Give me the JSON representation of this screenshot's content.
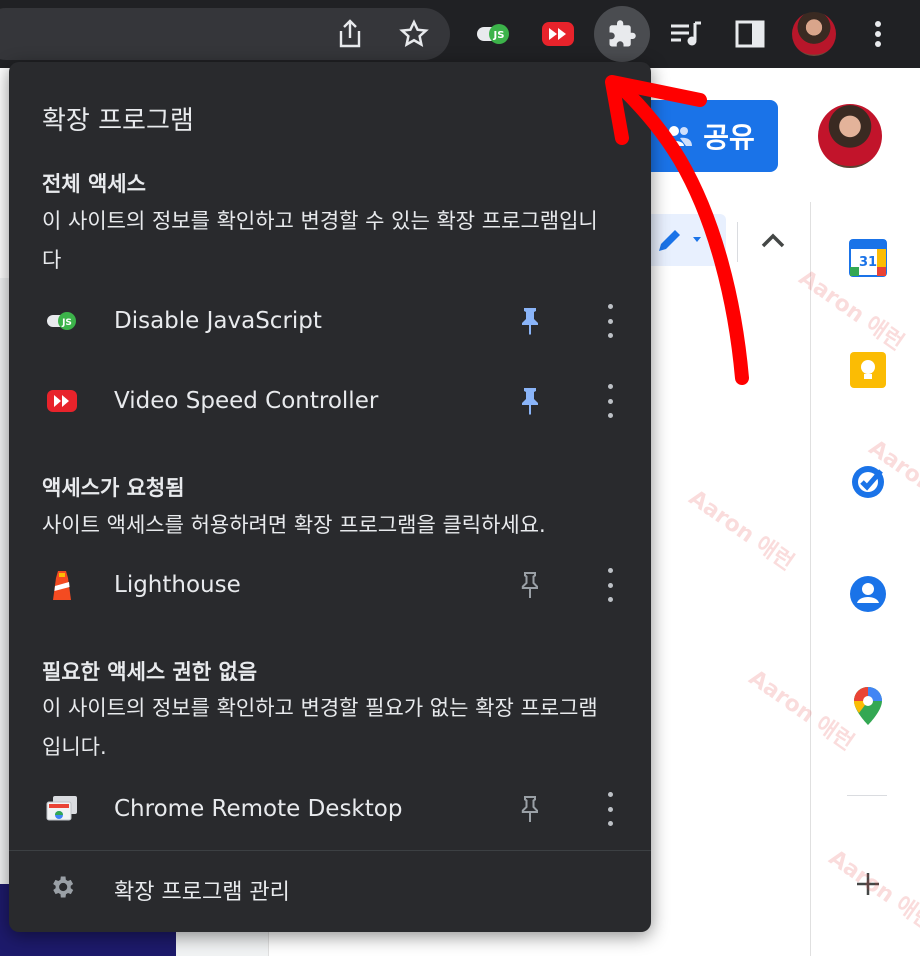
{
  "browser": {
    "toolbar_icons": [
      "share-icon",
      "star-icon",
      "disable-javascript-ext-icon",
      "video-speed-controller-ext-icon",
      "puzzle-extensions-icon",
      "reading-list-icon",
      "side-panel-icon",
      "profile-avatar",
      "more-vert-icon"
    ]
  },
  "page": {
    "share_label": "공유",
    "calendar_day": "31",
    "watermark": "Aaron 애런"
  },
  "extensions_popup": {
    "title": "확장 프로그램",
    "sections": [
      {
        "heading": "전체 액세스",
        "description": "이 사이트의 정보를 확인하고 변경할 수 있는 확장 프로그램입니다",
        "items": [
          {
            "name": "Disable JavaScript",
            "icon": "disable-javascript-icon",
            "pinned": true
          },
          {
            "name": "Video Speed Controller",
            "icon": "video-speed-controller-icon",
            "pinned": true
          }
        ]
      },
      {
        "heading": "액세스가 요청됨",
        "description": "사이트 액세스를 허용하려면 확장 프로그램을 클릭하세요.",
        "items": [
          {
            "name": "Lighthouse",
            "icon": "lighthouse-icon",
            "pinned": false
          }
        ]
      },
      {
        "heading": "필요한 액세스 권한 없음",
        "description": "이 사이트의 정보를 확인하고 변경할 필요가 없는 확장 프로그램입니다.",
        "items": [
          {
            "name": "Chrome Remote Desktop",
            "icon": "chrome-remote-desktop-icon",
            "pinned": false
          }
        ]
      }
    ],
    "manage_label": "확장 프로그램 관리"
  },
  "colors": {
    "popup_bg": "#292a2d",
    "toolbar_bg": "#202124",
    "pinned_blue": "#8ab4f8",
    "share_blue": "#1a73e8",
    "annotation_red": "#ff0000"
  }
}
